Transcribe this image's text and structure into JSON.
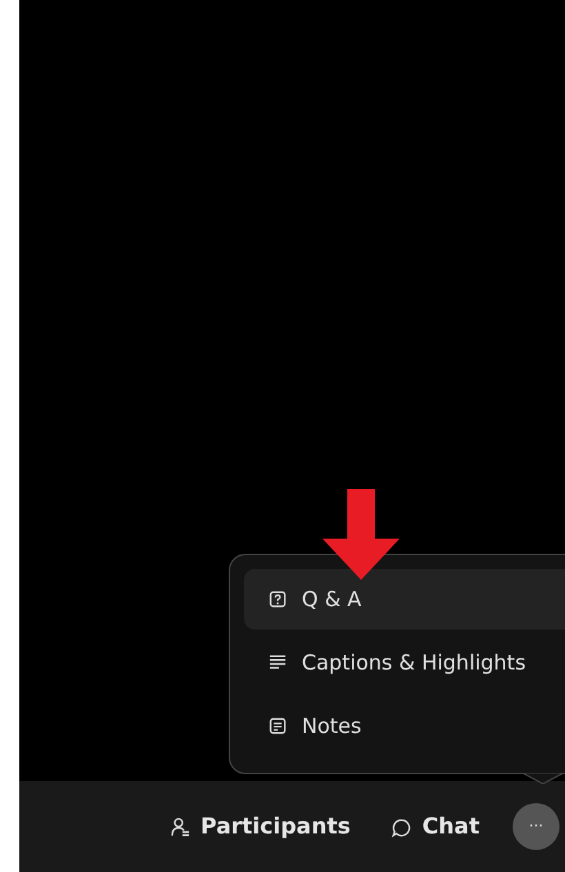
{
  "menu": {
    "items": [
      {
        "kind": "qa",
        "label": "Q & A",
        "selected": true
      },
      {
        "kind": "captions",
        "label": "Captions & Highlights",
        "selected": false
      },
      {
        "kind": "notes",
        "label": "Notes",
        "selected": false
      }
    ]
  },
  "toolbar": {
    "buttons": [
      {
        "kind": "participants",
        "label": "Participants"
      },
      {
        "kind": "chat",
        "label": "Chat"
      }
    ],
    "more": {
      "label": "···",
      "expanded": true
    }
  }
}
